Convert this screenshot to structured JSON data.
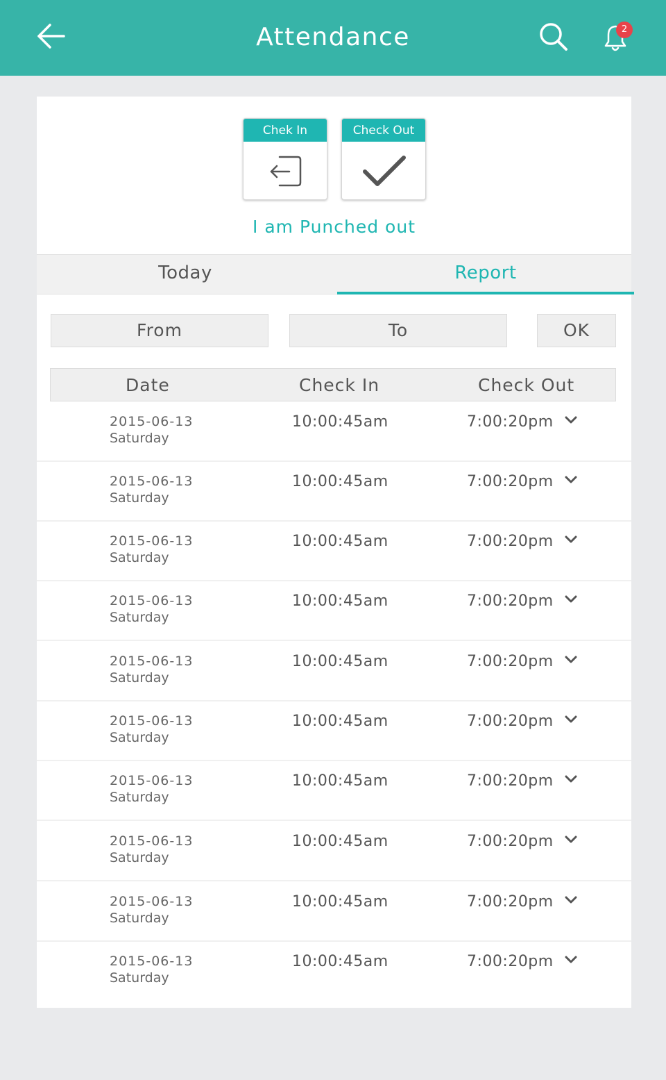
{
  "header": {
    "title": "Attendance",
    "notification_count": "2",
    "accent_color": "#37b4a8",
    "badge_color": "#e8434a"
  },
  "punch": {
    "check_in_label": "Chek In",
    "check_out_label": "Check Out",
    "status_text": "I am Punched out"
  },
  "tabs": [
    {
      "label": "Today"
    },
    {
      "label": "Report"
    }
  ],
  "filter": {
    "from_label": "From",
    "to_label": "To",
    "ok_label": "OK"
  },
  "table": {
    "columns": [
      "Date",
      "Check In",
      "Check Out"
    ],
    "rows": [
      {
        "date": "2015-06-13",
        "day": "Saturday",
        "check_in": "10:00:45am",
        "check_out": "7:00:20pm"
      },
      {
        "date": "2015-06-13",
        "day": "Saturday",
        "check_in": "10:00:45am",
        "check_out": "7:00:20pm"
      },
      {
        "date": "2015-06-13",
        "day": "Saturday",
        "check_in": "10:00:45am",
        "check_out": "7:00:20pm"
      },
      {
        "date": "2015-06-13",
        "day": "Saturday",
        "check_in": "10:00:45am",
        "check_out": "7:00:20pm"
      },
      {
        "date": "2015-06-13",
        "day": "Saturday",
        "check_in": "10:00:45am",
        "check_out": "7:00:20pm"
      },
      {
        "date": "2015-06-13",
        "day": "Saturday",
        "check_in": "10:00:45am",
        "check_out": "7:00:20pm"
      },
      {
        "date": "2015-06-13",
        "day": "Saturday",
        "check_in": "10:00:45am",
        "check_out": "7:00:20pm"
      },
      {
        "date": "2015-06-13",
        "day": "Saturday",
        "check_in": "10:00:45am",
        "check_out": "7:00:20pm"
      },
      {
        "date": "2015-06-13",
        "day": "Saturday",
        "check_in": "10:00:45am",
        "check_out": "7:00:20pm"
      },
      {
        "date": "2015-06-13",
        "day": "Saturday",
        "check_in": "10:00:45am",
        "check_out": "7:00:20pm"
      }
    ]
  }
}
